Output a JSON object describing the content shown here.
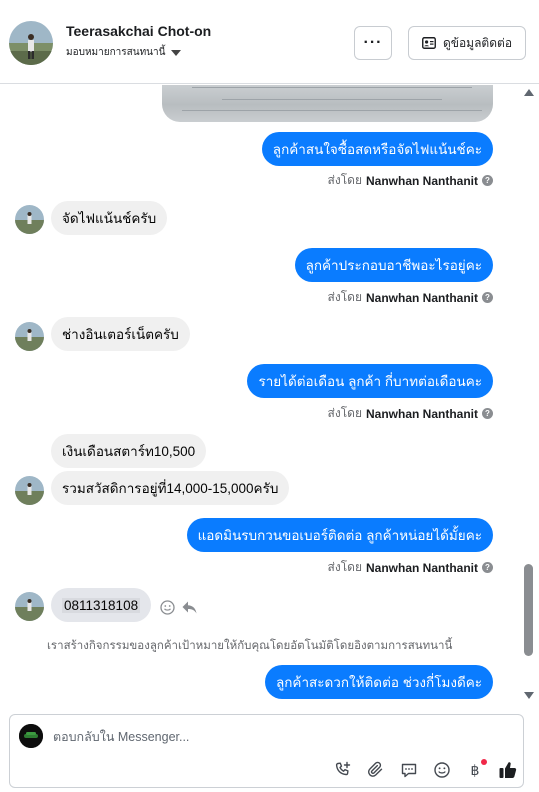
{
  "header": {
    "name": "Teerasakchai Chot-on",
    "assign_label": "มอบหมายการสนทนานี้",
    "more_label": "···",
    "contact_label": "ดูข้อมูลติดต่อ"
  },
  "messages": {
    "m1": "ลูกค้าสนใจซื้อสดหรือจัดไฟแน้นช์คะ",
    "m2": "จัดไฟแน้นช์ครับ",
    "m3": "ลูกค้าประกอบอาชีพอะไรอยู่คะ",
    "m4": "ช่างอินเตอร์เน็ตครับ",
    "m5": "รายได้ต่อเดือน  ลูกค้า กี่บาทต่อเดือนคะ",
    "m6": "เงินเดือนสตาร์ท10,500",
    "m7": "รวมสวัสดิการอยู่ที่14,000-15,000ครับ",
    "m8": "แอดมินรบกวนขอเบอร์ติดต่อ ลูกค้าหน่อยได้มั้ยคะ",
    "m9": "0811318108",
    "m10": "ลูกค้าสะดวกให้ติดต่อ ช่วงกี่โมงดีคะ"
  },
  "sent_by": {
    "prefix": "ส่งโดย",
    "agent": "Nanwhan Nanthanit"
  },
  "notice": "เราสร้างกิจกรรมของลูกค้าเป้าหมายให้กับคุณโดยอัตโนมัติโดยอิงตามการสนทนานี้",
  "composer": {
    "placeholder": "ตอบกลับใน Messenger..."
  },
  "colors": {
    "outgoing_bubble": "#0a7cff",
    "incoming_bubble": "#f0f0f0",
    "like": "#1c1e21",
    "badge": "#f02849"
  }
}
